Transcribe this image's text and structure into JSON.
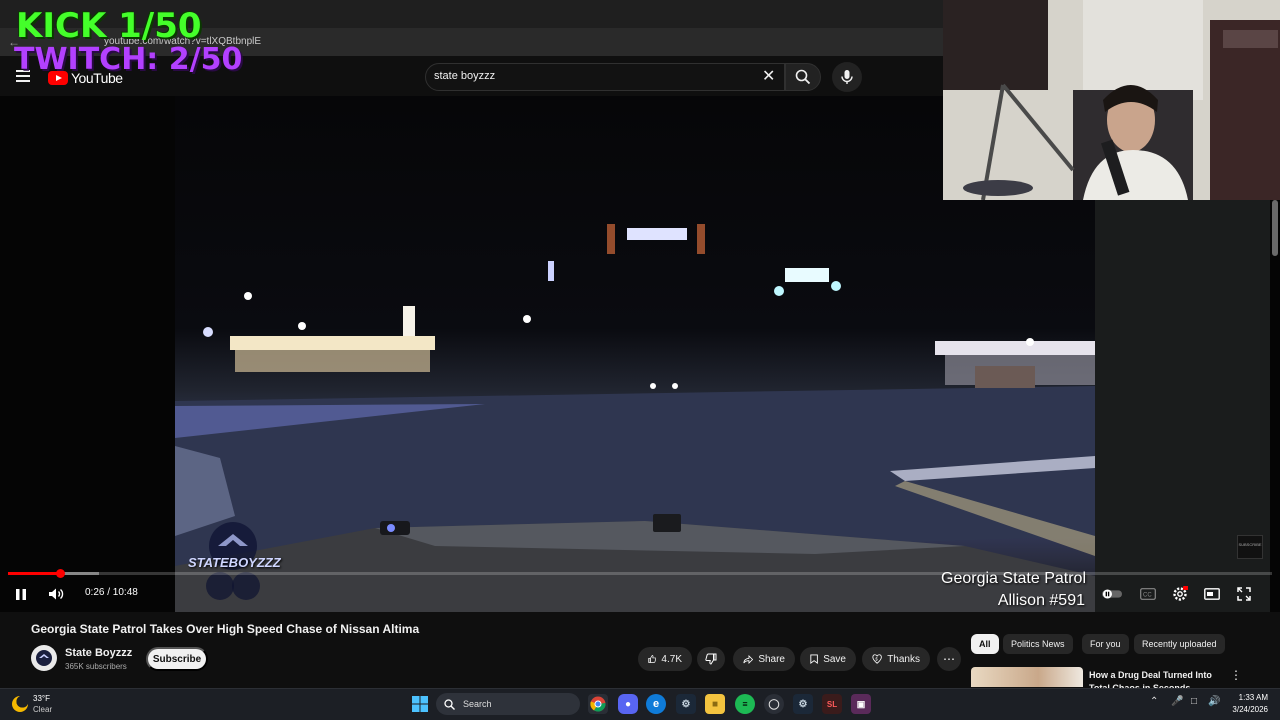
{
  "overlay": {
    "kick": "KICK 1/50",
    "twitch": "TWITCH: 2/50"
  },
  "browser": {
    "url": "youtube.com/watch?v=tlXQBtbnplE"
  },
  "header": {
    "logo_text": "YouTube",
    "search_value": "state boyzzz"
  },
  "video": {
    "caption_line1": "Georgia State Patrol",
    "caption_line2": "Allison #591",
    "watermark": "STATEBOYZZZ",
    "time_display": "0:26 / 10:48",
    "progress_fraction": 0.041,
    "buffer_fraction": 0.072
  },
  "details": {
    "title": "Georgia State Patrol Takes Over High Speed Chase of Nissan Altima",
    "channel_name": "State Boyzzz",
    "subscribers": "365K subscribers",
    "subscribe_label": "Subscribe",
    "like_count": "4.7K",
    "share_label": "Share",
    "save_label": "Save",
    "thanks_label": "Thanks"
  },
  "chips": [
    "All",
    "Politics News",
    "For you",
    "Recently uploaded"
  ],
  "recommendation": {
    "title": "How a Drug Deal Turned Into Total Chaos in Seconds"
  },
  "taskbar": {
    "weather_temp": "33°F",
    "weather_desc": "Clear",
    "search_label": "Search",
    "time": "1:33 AM",
    "date": "3/24/2026"
  },
  "colors": {
    "yt_red": "#ff0000",
    "kick_green": "#44ff2a",
    "twitch_purple": "#b340ff"
  }
}
